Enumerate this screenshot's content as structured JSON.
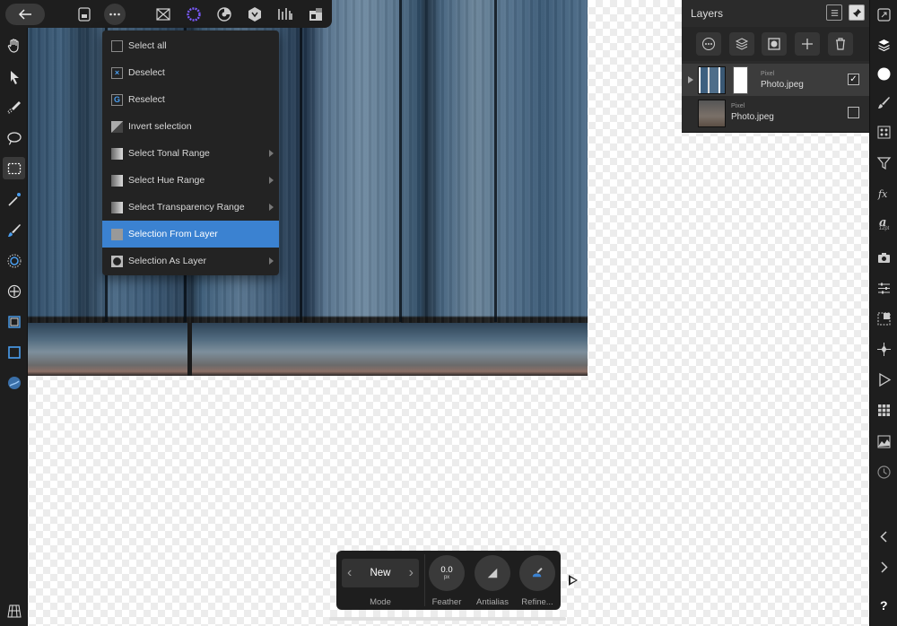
{
  "top_bar": {
    "icons": [
      "back-arrow-icon",
      "document-icon",
      "more-icon",
      "pixel-persona-icon",
      "liquify-persona-icon",
      "develop-persona-icon",
      "tone-mapping-persona-icon",
      "histogram-icon",
      "export-persona-icon"
    ]
  },
  "select_menu": {
    "items": [
      {
        "label": "Select all",
        "icon": "checkbox-empty-icon",
        "submenu": false
      },
      {
        "label": "Deselect",
        "icon": "deselect-x-icon",
        "submenu": false
      },
      {
        "label": "Reselect",
        "icon": "reselect-icon",
        "submenu": false
      },
      {
        "label": "Invert selection",
        "icon": "invert-selection-icon",
        "submenu": false
      },
      {
        "label": "Select Tonal Range",
        "icon": "tonal-range-icon",
        "submenu": true
      },
      {
        "label": "Select Hue Range",
        "icon": "hue-range-icon",
        "submenu": true
      },
      {
        "label": "Select Transparency Range",
        "icon": "transparency-range-icon",
        "submenu": true
      },
      {
        "label": "Selection From Layer",
        "icon": "selection-from-layer-icon",
        "submenu": false,
        "active": true
      },
      {
        "label": "Selection As Layer",
        "icon": "selection-as-layer-icon",
        "submenu": true
      }
    ]
  },
  "layers_panel": {
    "title": "Layers",
    "layers": [
      {
        "type": "Pixel",
        "name": "Photo.jpeg",
        "checked": true,
        "selected": true
      },
      {
        "type": "Pixel",
        "name": "Photo.jpeg",
        "checked": false,
        "selected": false
      }
    ]
  },
  "right_toolbar": {
    "font_size_label": "12pt"
  },
  "context_bar": {
    "mode_value": "New",
    "mode_label": "Mode",
    "feather_value": "0.0",
    "feather_unit": "px",
    "feather_label": "Feather",
    "antialias_label": "Antialias",
    "refine_label": "Refine..."
  },
  "colors": {
    "accent": "#3b82d1",
    "panel_bg": "#1e1e1e"
  }
}
